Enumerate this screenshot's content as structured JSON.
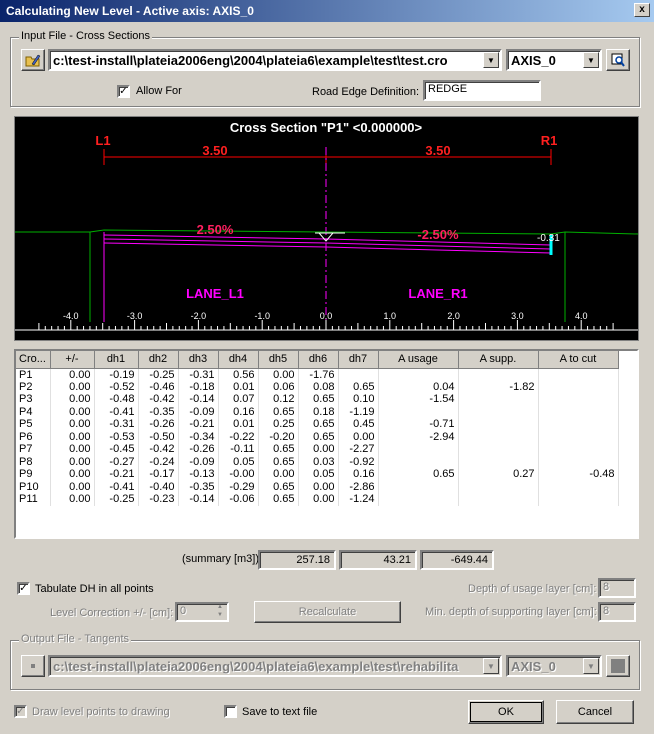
{
  "window": {
    "title": "Calculating New Level - Active axis: AXIS_0",
    "close": "x"
  },
  "input_group": {
    "label": "Input File - Cross Sections",
    "file": "c:\\test-install\\plateia2006eng\\2004\\plateia6\\example\\test\\test.cro",
    "axis": "AXIS_0",
    "allow_for_label": "Allow For",
    "allow_for_checked": true,
    "road_edge_label": "Road Edge Definition:",
    "road_edge_value": "REDGE"
  },
  "cross_section": {
    "title": "Cross Section \"P1\" <0.000000>",
    "left_point": "L1",
    "right_point": "R1",
    "left_width": "3.50",
    "right_width": "3.50",
    "left_slope": "2.50%",
    "right_slope": "-2.50%",
    "edge_value": "-0.31",
    "left_lane": "LANE_L1",
    "right_lane": "LANE_R1",
    "ruler": [
      "-4.0",
      "-3.0",
      "-2.0",
      "-1.0",
      "0.0",
      "1.0",
      "2.0",
      "3.0",
      "4.0"
    ],
    "colors": {
      "ruler": "#ffffff",
      "slopes": "#ff00ff",
      "dims": "#ff0000",
      "ground": "#00c000",
      "edge": "#00ffff"
    }
  },
  "table": {
    "columns": [
      "Cro...",
      "+/-",
      "dh1",
      "dh2",
      "dh3",
      "dh4",
      "dh5",
      "dh6",
      "dh7",
      "A usage",
      "A supp.",
      "A to cut"
    ],
    "rows": [
      [
        "P1",
        "0.00",
        "-0.19",
        "-0.25",
        "-0.31",
        "0.56",
        "0.00",
        "-1.76",
        "",
        "",
        "",
        ""
      ],
      [
        "P2",
        "0.00",
        "-0.52",
        "-0.46",
        "-0.18",
        "0.01",
        "0.06",
        "0.08",
        "0.65",
        "0.04",
        "-1.82",
        ""
      ],
      [
        "P3",
        "0.00",
        "-0.48",
        "-0.42",
        "-0.14",
        "0.07",
        "0.12",
        "0.65",
        "0.10",
        "-1.54",
        "",
        ""
      ],
      [
        "P4",
        "0.00",
        "-0.41",
        "-0.35",
        "-0.09",
        "0.16",
        "0.65",
        "0.18",
        "-1.19",
        "",
        "",
        ""
      ],
      [
        "P5",
        "0.00",
        "-0.31",
        "-0.26",
        "-0.21",
        "0.01",
        "0.25",
        "0.65",
        "0.45",
        "-0.71",
        "",
        ""
      ],
      [
        "P6",
        "0.00",
        "-0.53",
        "-0.50",
        "-0.34",
        "-0.22",
        "-0.20",
        "0.65",
        "0.00",
        "-2.94",
        "",
        ""
      ],
      [
        "P7",
        "0.00",
        "-0.45",
        "-0.42",
        "-0.26",
        "-0.11",
        "0.65",
        "0.00",
        "-2.27",
        "",
        "",
        ""
      ],
      [
        "P8",
        "0.00",
        "-0.27",
        "-0.24",
        "-0.09",
        "0.05",
        "0.65",
        "0.03",
        "-0.92",
        "",
        "",
        ""
      ],
      [
        "P9",
        "0.00",
        "-0.21",
        "-0.17",
        "-0.13",
        "-0.00",
        "0.00",
        "0.05",
        "0.16",
        "0.65",
        "0.27",
        "-0.48"
      ],
      [
        "P10",
        "0.00",
        "-0.41",
        "-0.40",
        "-0.35",
        "-0.29",
        "0.65",
        "0.00",
        "-2.86",
        "",
        "",
        ""
      ],
      [
        "P11",
        "0.00",
        "-0.25",
        "-0.23",
        "-0.14",
        "-0.06",
        "0.65",
        "0.00",
        "-1.24",
        "",
        "",
        ""
      ]
    ]
  },
  "summary": {
    "label": "(summary [m3])",
    "usage": "257.18",
    "supp": "43.21",
    "cut": "-649.44"
  },
  "options": {
    "tabulate_label": "Tabulate DH in all points",
    "tabulate_checked": true,
    "level_correction_label": "Level Correction +/-  [cm]:",
    "level_correction_value": "0",
    "recalculate": "Recalculate",
    "depth_usage_label": "Depth of usage layer [cm]:",
    "depth_usage_value": "8",
    "min_depth_label": "Min. depth of supporting layer [cm]:",
    "min_depth_value": "8"
  },
  "output_group": {
    "label": "Output File - Tangents",
    "file": "c:\\test-install\\plateia2006eng\\2004\\plateia6\\example\\test\\rehabilita",
    "axis": "AXIS_0"
  },
  "footer": {
    "draw_points_label": "Draw level points to drawing",
    "save_text_label": "Save to text file",
    "ok": "OK",
    "cancel": "Cancel"
  }
}
